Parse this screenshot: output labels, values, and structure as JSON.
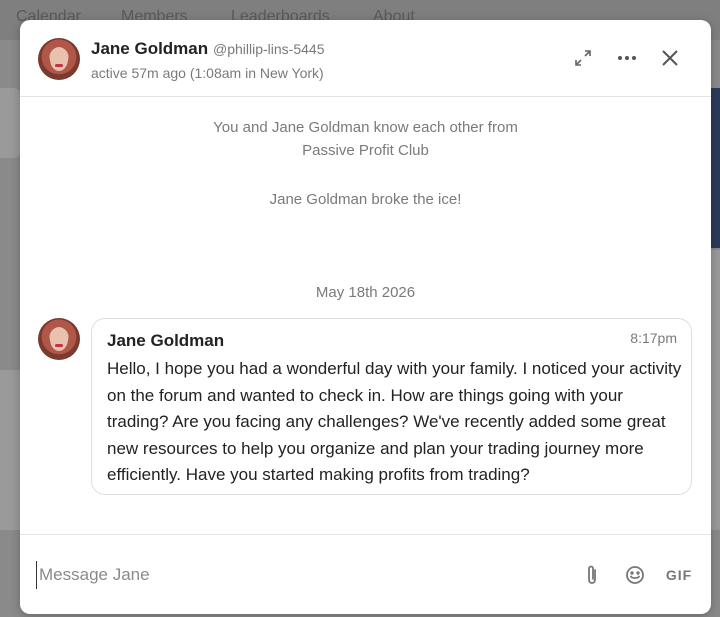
{
  "background": {
    "nav": [
      "Calendar",
      "Members",
      "Leaderboards",
      "About"
    ]
  },
  "header": {
    "name": "Jane Goldman",
    "handle": "@phillip-lins-5445",
    "status": "active 57m ago (1:08am in New York)",
    "icons": [
      "expand-icon",
      "more-icon",
      "close-icon"
    ]
  },
  "system": {
    "line1": "You and Jane Goldman know each other from",
    "line2": "Passive Profit Club",
    "line3": "Jane Goldman broke the ice!",
    "date": "May 18th 2026"
  },
  "message": {
    "author": "Jane Goldman",
    "time": "8:17pm",
    "text": "Hello, I hope you had a wonderful day with your family. I noticed your activity on the forum and wanted to check in. How are things going with your trading? Are you facing any challenges? We've recently added some great new resources to help you organize and plan your trading journey more efficiently. Have you started making profits from trading?"
  },
  "composer": {
    "placeholder": "Message Jane",
    "value": "",
    "gif_label": "GIF"
  },
  "colors": {
    "overlay": "#8a8a8a",
    "text": "#222222",
    "muted": "#7a7a7a",
    "border": "#dedede"
  }
}
